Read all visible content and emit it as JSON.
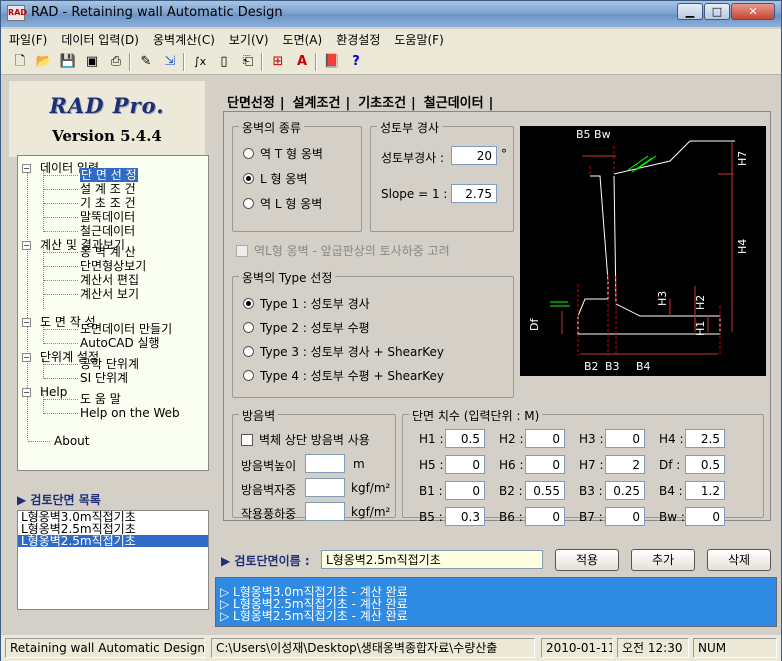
{
  "window": {
    "title": "RAD - Retaining wall Automatic Design"
  },
  "menu": [
    "파일(F)",
    "데이터 입력(D)",
    "옹벽계산(C)",
    "보기(V)",
    "도면(A)",
    "환경설정",
    "도움말(F)"
  ],
  "logo": {
    "name": "RAD Pro.",
    "version": "Version 5.4.4"
  },
  "tree": {
    "input": {
      "label": "데이터 입력",
      "children": [
        "단 면 선 정",
        "설 계 조 건",
        "기 초 조 건",
        "말뚝데이터",
        "철근데이터"
      ]
    },
    "calc": {
      "label": "계산 및 결과보기",
      "children": [
        "옹 벽 계 산",
        "단면형상보기",
        "계산서 편집",
        "계산서 보기"
      ]
    },
    "draw": {
      "label": "도 면 작 성",
      "children": [
        "도면데이터 만들기",
        "AutoCAD 실행"
      ]
    },
    "unit": {
      "label": "단위계 설정",
      "children": [
        "공학 단위계",
        "SI 단위계"
      ]
    },
    "help": {
      "label": "Help",
      "children": [
        "도 움 말",
        "Help on the Web"
      ]
    },
    "about": "About"
  },
  "review_list": {
    "title": "▶ 검토단면 목록",
    "items": [
      "L형옹벽3.0m직접기초",
      "L형옹벽2.5m직접기초",
      "L형옹벽2.5m직접기초"
    ]
  },
  "tabs": [
    "단면선정",
    "설계조건",
    "기초조건",
    "철근데이터"
  ],
  "wall_type": {
    "title": "옹벽의 종류",
    "options": [
      "역 T 형 옹벽",
      "L 형 옹벽",
      "역 L 형 옹벽"
    ],
    "selected": "L 형 옹벽"
  },
  "slope": {
    "title": "성토부 경사",
    "angle_label": "성토부경사 :",
    "angle_value": "20",
    "angle_unit": "°",
    "ratio_label": "Slope = 1 :",
    "ratio_value": "2.75"
  },
  "reverse_l_check": "역L형 옹벽 - 앞굽판상의 토사하중 고려",
  "type_select": {
    "title": "옹벽의 Type 선정",
    "options": [
      "Type 1 : 성토부 경사",
      "Type 2 : 성토부 수평",
      "Type 3 : 성토부 경사 + ShearKey",
      "Type 4 : 성토부 수평 + ShearKey"
    ],
    "selected": "Type 1 : 성토부 경사"
  },
  "barrier": {
    "title": "방음벽",
    "check_label": "벽체 상단 방음벽 사용",
    "height_label": "방음벽높이",
    "height_value": "",
    "height_unit": "m",
    "weight_label": "방음벽자중",
    "weight_value": "",
    "weight_unit": "kgf/m²",
    "load_label": "작용풍하중",
    "load_value": "",
    "load_unit": "kgf/m²"
  },
  "dimensions": {
    "title": "단면 치수 (입력단위 : M)",
    "fields": [
      {
        "label": "H1 :",
        "value": "0.5"
      },
      {
        "label": "H2 :",
        "value": "0"
      },
      {
        "label": "H3 :",
        "value": "0"
      },
      {
        "label": "H4 :",
        "value": "2.5"
      },
      {
        "label": "H5 :",
        "value": "0"
      },
      {
        "label": "H6 :",
        "value": "0"
      },
      {
        "label": "H7 :",
        "value": "2"
      },
      {
        "label": "Df :",
        "value": "0.5"
      },
      {
        "label": "B1 :",
        "value": "0"
      },
      {
        "label": "B2 :",
        "value": "0.55"
      },
      {
        "label": "B3 :",
        "value": "0.25"
      },
      {
        "label": "B4 :",
        "value": "1.2"
      },
      {
        "label": "B5 :",
        "value": "0.3"
      },
      {
        "label": "B6 :",
        "value": "0"
      },
      {
        "label": "B7 :",
        "value": "0"
      },
      {
        "label": "Bw :",
        "value": "0"
      }
    ]
  },
  "diagram_labels": {
    "b5bw": "B5 Bw",
    "h7": "H7",
    "h4": "H4",
    "h3": "H3",
    "h1": "H1",
    "h2": "H2",
    "df": "Df",
    "b2": "B2",
    "b3": "B3",
    "b4": "B4"
  },
  "section_name": {
    "label": "▶ 검토단면이름 :",
    "value": "L형옹벽2.5m직접기초"
  },
  "buttons": {
    "apply": "적용",
    "add": "추가",
    "delete": "삭제"
  },
  "messages": [
    "▷ L형옹벽3.0m직접기초 -  계산 완료",
    "▷ L형옹벽2.5m직접기초 -  계산 완료",
    "▷ L형옹벽2.5m직접기초 -  계산 완료"
  ],
  "status": {
    "app": "Retaining wall Automatic Design",
    "path": "C:\\Users\\이성재\\Desktop\\생태옹벽종합자료\\수량산출",
    "date": "2010-01-11",
    "time": "오전 12:30",
    "num": "NUM"
  },
  "colors": {
    "accent": "#316ac5",
    "messages_bg": "#2e8ae2",
    "logo": "#1f2e78",
    "diagram_bg": "#000000"
  }
}
